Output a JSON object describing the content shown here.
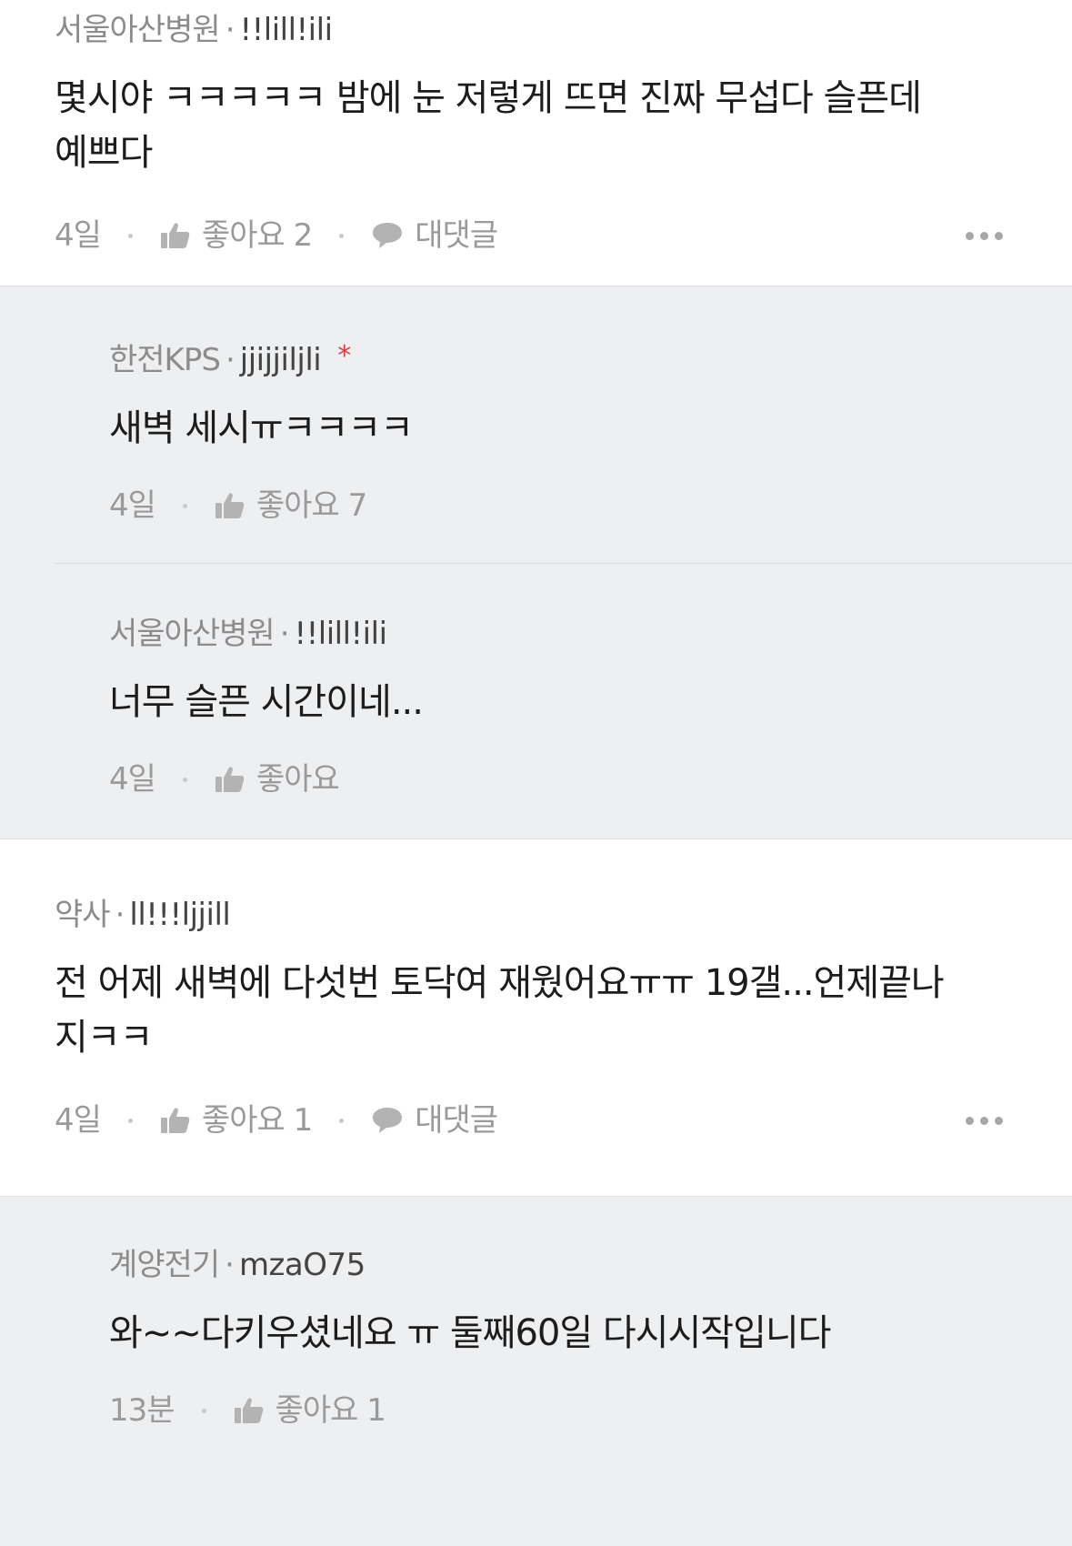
{
  "comments": [
    {
      "author": "서울아산병원",
      "nick": "!!lill!ili",
      "text": "몇시야 ㅋㅋㅋㅋㅋ 밤에 눈 저렇게 뜨면 진짜 무섭다 슬픈데\n예쁘다",
      "time": "4일",
      "like_label": "좋아요 2",
      "reply_label": "대댓글",
      "replies": [
        {
          "author": "한전KPS",
          "nick": "jjijjiljli",
          "star": "*",
          "text": "새벽 세시ㅠㅋㅋㅋㅋ",
          "time": "4일",
          "like_label": "좋아요 7"
        },
        {
          "author": "서울아산병원",
          "nick": "!!lill!ili",
          "text": "너무 슬픈 시간이네...",
          "time": "4일",
          "like_label": "좋아요"
        }
      ]
    },
    {
      "author": "약사",
      "nick": "ll!!!ljjill",
      "text": "전 어제 새벽에 다섯번 토닥여 재웠어요ㅠㅠ 19갤...언제끝나\n지ㅋㅋ",
      "time": "4일",
      "like_label": "좋아요 1",
      "reply_label": "대댓글",
      "replies": [
        {
          "author": "계양전기",
          "nick": "mzaO75",
          "text": "와~~다키우셨네요 ㅠ 둘째60일 다시시작입니다",
          "time": "13분",
          "like_label": "좋아요 1"
        }
      ]
    }
  ],
  "separator": "·",
  "icons": {
    "like": "thumbs-up-icon",
    "reply": "speech-bubble-icon",
    "more": "more-dots-icon"
  },
  "colors": {
    "reply_background": "#eeeff1",
    "star": "#e0393e"
  }
}
